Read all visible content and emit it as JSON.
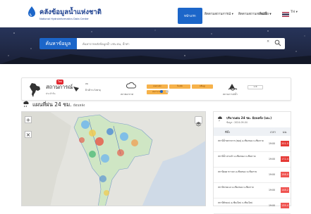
{
  "header": {
    "title": "คลังข้อมูลน้ำแห่งชาติ",
    "subtitle": "National Hydroinformatics Data Center",
    "nav": [
      {
        "label": "หน้าแรก",
        "active": true
      },
      {
        "label": "ติดตามสถานการณ์ ▾",
        "active": false
      },
      {
        "label": "ติดตามสถานการณ์น้ำ ▾",
        "active": false
      },
      {
        "label": "เพิ่มเติม ▾",
        "active": false
      }
    ],
    "language": "TH ▾"
  },
  "hero": {
    "search_button": "ค้นหาข้อมูล",
    "search_placeholder": "ค้นหาจากคลังข้อมูลน้ำ เช่น ฝน, น้ำท่า",
    "clear_icon": "×",
    "search_icon": "magnifier-icon"
  },
  "status": {
    "title": "สถานการณ์",
    "subtitle": "ประจำวัน",
    "badge": "ใหม่",
    "wind_text_1": "ลม",
    "wind_text_2": "ฝ้าเฝ้าระวังพายุ",
    "weather_label": "สภาพอากาศ",
    "chips": [
      "ฝนตกหนัก",
      "ร้อนจัด",
      "คลื่นสูง"
    ],
    "chip2": "ฝนปานกลาง",
    "flood_label": "สถานการณ์น้ำ",
    "flood_chip": "ปกติ",
    "dot_active_color": "#1c66c9",
    "dot_inactive_color": "#c9c9c9"
  },
  "section": {
    "title": "แผนที่ฝน 24 ชม.",
    "subtitle": "ย้อนหลัง"
  },
  "map": {
    "zoom_in": "+",
    "zoom_out": "×",
    "layers_icon": "layers-icon"
  },
  "rain_table": {
    "title": "ปริมาณฝน 24 ชม. ย้อนหลัง (มม.)",
    "date": "ข้อมูล : 2024-09-04",
    "columns": [
      "ที่ตั้ง",
      "เวลา",
      "มม."
    ],
    "rows": [
      {
        "station": "สถานีน้ำหลากลาก (พอง) อ.เชียงของ จ.เชียงราย",
        "time": "19:00",
        "value": "201.5",
        "color": "#e53935"
      },
      {
        "station": "สถานีน้ำ ฝางเจ้า อ.เชียงของ จ.เชียงราย",
        "time": "19:00",
        "value": "172.4",
        "color": "#e53935"
      },
      {
        "station": "สถานีดอย ขาวนก อ.เชียงของ จ.เชียงราย",
        "time": "19:00",
        "value": "158.0",
        "color": "#ef5350"
      },
      {
        "station": "สถานีขาดแนว อ.เชียงของ จ.เชียงราย",
        "time": "19:00",
        "value": "148.2",
        "color": "#ef5350"
      },
      {
        "station": "สถานีห้วยแม่ อ.เชียงใหม่ จ.เชียงใหม่",
        "time": "19:00",
        "value": "135.4",
        "color": "#ef5350"
      }
    ]
  }
}
